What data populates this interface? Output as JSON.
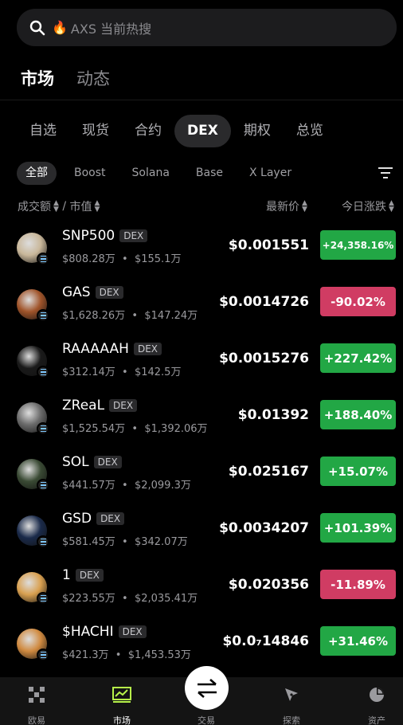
{
  "search": {
    "placeholder": "AXS 当前热搜"
  },
  "main_tabs": [
    {
      "label": "市场"
    },
    {
      "label": "动态"
    }
  ],
  "category_tabs": [
    {
      "label": "自选"
    },
    {
      "label": "现货"
    },
    {
      "label": "合约"
    },
    {
      "label": "DEX"
    },
    {
      "label": "期权"
    },
    {
      "label": "总览"
    }
  ],
  "chain_tabs": [
    {
      "label": "全部"
    },
    {
      "label": "Boost"
    },
    {
      "label": "Solana"
    },
    {
      "label": "Base"
    },
    {
      "label": "X Layer"
    }
  ],
  "columns": {
    "volume_mcap_a": "成交额",
    "volume_mcap_sep": " / ",
    "volume_mcap_b": "市值",
    "last_price": "最新价",
    "change_today": "今日涨跌"
  },
  "tokens": [
    {
      "name": "SNP500",
      "tag": "DEX",
      "volume": "$808.28万",
      "mcap": "$155.1万",
      "price": "$0.001551",
      "change": "+24,358.16%",
      "direction": "up",
      "avatar_color": "#c9b79a"
    },
    {
      "name": "GAS",
      "tag": "DEX",
      "volume": "$1,628.26万",
      "mcap": "$147.24万",
      "price": "$0.0014726",
      "change": "-90.02%",
      "direction": "down",
      "avatar_color": "#a0542a"
    },
    {
      "name": "RAAAAAH",
      "tag": "DEX",
      "volume": "$312.14万",
      "mcap": "$142.5万",
      "price": "$0.0015276",
      "change": "+227.42%",
      "direction": "up",
      "avatar_color": "#1a1a1a"
    },
    {
      "name": "ZReaL",
      "tag": "DEX",
      "volume": "$1,525.54万",
      "mcap": "$1,392.06万",
      "price": "$0.01392",
      "change": "+188.40%",
      "direction": "up",
      "avatar_color": "#6a6a6a"
    },
    {
      "name": "SOL",
      "tag": "DEX",
      "volume": "$441.57万",
      "mcap": "$2,099.3万",
      "price": "$0.025167",
      "change": "+15.07%",
      "direction": "up",
      "avatar_color": "#3a4a34"
    },
    {
      "name": "GSD",
      "tag": "DEX",
      "volume": "$581.45万",
      "mcap": "$342.07万",
      "price": "$0.0034207",
      "change": "+101.39%",
      "direction": "up",
      "avatar_color": "#1a2a4a"
    },
    {
      "name": "1",
      "tag": "DEX",
      "volume": "$223.55万",
      "mcap": "$2,035.41万",
      "price": "$0.020356",
      "change": "-11.89%",
      "direction": "down",
      "avatar_color": "#d9a050"
    },
    {
      "name": "$HACHI",
      "tag": "DEX",
      "volume": "$421.3万",
      "mcap": "$1,453.53万",
      "price": "$0.0₇14846",
      "change": "+31.46%",
      "direction": "up",
      "avatar_color": "#d08a40"
    }
  ],
  "colors": {
    "up": "#22a745",
    "down": "#d03c63",
    "accent_green": "#b7f34a"
  },
  "bottom_nav": [
    {
      "label": "欧易",
      "icon": "okx-logo-icon"
    },
    {
      "label": "市场",
      "icon": "chart-icon",
      "active": true
    },
    {
      "label": "交易",
      "icon": "swap-icon"
    },
    {
      "label": "探索",
      "icon": "compass-icon"
    },
    {
      "label": "资产",
      "icon": "pie-chart-icon"
    }
  ]
}
